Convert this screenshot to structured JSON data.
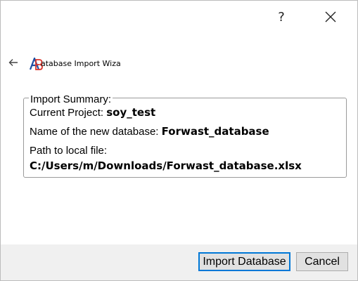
{
  "window": {
    "help_label": "?",
    "close_icon": "close-icon",
    "back_icon": "back-arrow-icon"
  },
  "header": {
    "logo_icon": "app-logo-icon",
    "title": "atabase Import Wiza"
  },
  "summary": {
    "group_title": "Import Summary:",
    "project_label": "Current Project:",
    "project_value": "soy_test",
    "dbname_label": "Name of the new database:",
    "dbname_value": "Forwast_database",
    "path_label": "Path to local file:",
    "path_value": "C:/Users/m/Downloads/Forwast_database.xlsx"
  },
  "footer": {
    "import_label": "Import Database",
    "cancel_label": "Cancel"
  },
  "colors": {
    "footer_bg": "#f0f0f0",
    "button_bg": "#e1e1e1",
    "focus_border": "#0078d7",
    "logo_blue": "#1f4fa3",
    "logo_red": "#d9342b"
  }
}
